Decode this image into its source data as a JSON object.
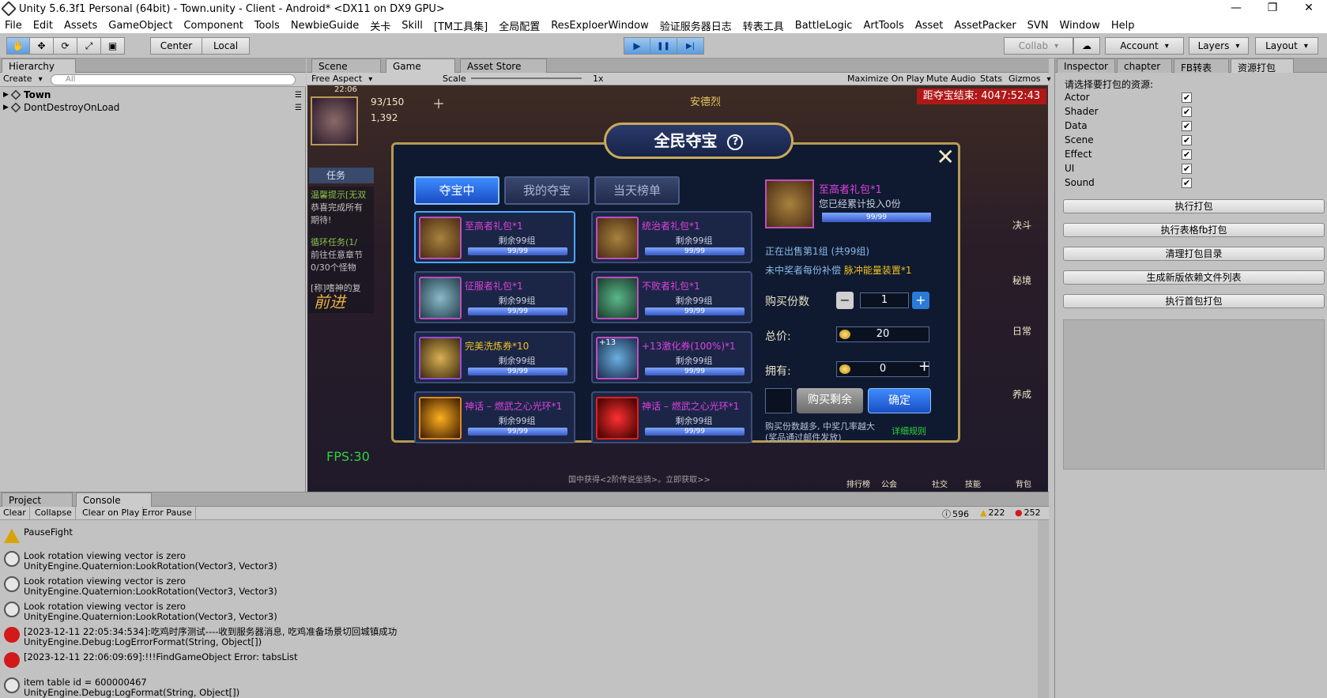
{
  "window": {
    "title": "Unity 5.6.3f1 Personal (64bit) - Town.unity - Client - Android* <DX11 on DX9 GPU>",
    "btn_min": "—",
    "btn_max": "❐",
    "btn_close": "✕"
  },
  "menu": [
    "File",
    "Edit",
    "Assets",
    "GameObject",
    "Component",
    "Tools",
    "NewbieGuide",
    "关卡",
    "Skill",
    "[TM工具集]",
    "全局配置",
    "ResExploerWindow",
    "验证服务器日志",
    "转表工具",
    "BattleLogic",
    "ArtTools",
    "Asset",
    "AssetPacker",
    "SVN",
    "Window",
    "Help"
  ],
  "toolbar": {
    "transform_tools": [
      "✋",
      "✥",
      "⟳",
      "⤢",
      "▣"
    ],
    "pivot": "Center",
    "space": "Local",
    "play": "▶",
    "pause": "❚❚",
    "step": "▶|",
    "collab": "Collab",
    "cloud": "☁",
    "account": "Account",
    "layers": "Layers",
    "layout": "Layout"
  },
  "hierarchy": {
    "tab": "Hierarchy",
    "create": "Create",
    "search_placeholder": "All",
    "items": [
      "Town",
      "DontDestroyOnLoad"
    ]
  },
  "game_panel": {
    "tabs": {
      "scene": "Scene",
      "game": "Game",
      "asset_store": "Asset Store"
    },
    "aspect": "Free Aspect",
    "scale_label": "Scale",
    "scale_value": "1x",
    "toggles": [
      "Maximize On Play",
      "Mute Audio",
      "Stats",
      "Gizmos"
    ]
  },
  "game": {
    "time": "22:06",
    "energy": "93/150",
    "gold": "1,392",
    "npc_name": "安德烈",
    "countdown": "距夺宝结束: 4047:52:43",
    "fps": "FPS:30",
    "task_label": "任务",
    "task_lines": [
      "温馨提示[无双",
      "恭喜完成所有",
      "期待!",
      "循环任务(1/",
      "前往任意章节",
      "0/30个怪物",
      "[称]嗜神的复"
    ],
    "forward": "前进",
    "side_icons": [
      "决斗",
      "秘境",
      "日常",
      "养成"
    ],
    "bottom_icons": [
      "排行榜",
      "公会",
      "社交",
      "技能",
      "背包"
    ],
    "bottom_hint": "国中获得<2阶传说坐骑>。立即获取>>",
    "dialog": {
      "title": "全民夺宝",
      "help": "?",
      "close": "✕",
      "tabs": [
        "夺宝中",
        "我的夺宝",
        "当天榜单"
      ],
      "items": [
        {
          "name": "至高者礼包*1",
          "remain": "剩余99组",
          "progress": "99/99"
        },
        {
          "name": "统治者礼包*1",
          "remain": "剩余99组",
          "progress": "99/99"
        },
        {
          "name": "征服者礼包*1",
          "remain": "剩余99组",
          "progress": "99/99"
        },
        {
          "name": "不败者礼包*1",
          "remain": "剩余99组",
          "progress": "99/99"
        },
        {
          "name": "完美洗炼券*10",
          "remain": "剩余99组",
          "progress": "99/99"
        },
        {
          "name": "+13激化券(100%)*1",
          "remain": "剩余99组",
          "progress": "99/99"
        },
        {
          "name": "神话 – 燃武之心光环*1",
          "remain": "剩余99组",
          "progress": "99/99"
        },
        {
          "name": "神话 – 燃武之心光环*1",
          "remain": "剩余99组",
          "progress": "99/99"
        }
      ],
      "item6_badge": "+13",
      "detail": {
        "name": "至高者礼包*1",
        "invested": "您已经累计投入0份",
        "progress": "99/99",
        "on_sale": "正在出售第1组 (共99组)",
        "compensation_prefix": "未中奖者每份补偿",
        "compensation_item": "脉冲能量装置*1",
        "buy_qty_label": "购买份数",
        "buy_qty": "1",
        "total_label": "总价:",
        "total_value": "20",
        "own_label": "拥有:",
        "own_value": "0",
        "buy_rest": "购买剩余",
        "confirm": "确定",
        "note1": "购买份数越多, 中奖几率越大",
        "note2": "(奖品通过邮件发放)",
        "rules": "详细规则"
      }
    }
  },
  "console": {
    "tabs": {
      "project": "Project",
      "console": "Console"
    },
    "buttons": [
      "Clear",
      "Collapse",
      "Clear on Play",
      "Error Pause"
    ],
    "counts": {
      "info": "596",
      "warn": "222",
      "error": "252"
    },
    "logs": [
      {
        "type": "warn",
        "line1": "PauseFight",
        "line2": ""
      },
      {
        "type": "info",
        "line1": "Look rotation viewing vector is zero",
        "line2": "UnityEngine.Quaternion:LookRotation(Vector3, Vector3)"
      },
      {
        "type": "info",
        "line1": "Look rotation viewing vector is zero",
        "line2": "UnityEngine.Quaternion:LookRotation(Vector3, Vector3)"
      },
      {
        "type": "info",
        "line1": "Look rotation viewing vector is zero",
        "line2": "UnityEngine.Quaternion:LookRotation(Vector3, Vector3)"
      },
      {
        "type": "error",
        "line1": "[2023-12-11 22:05:34:534]:吃鸡时序测试----收到服务器消息, 吃鸡准备场景切回城镇成功",
        "line2": "UnityEngine.Debug:LogErrorFormat(String, Object[])"
      },
      {
        "type": "error",
        "line1": "[2023-12-11 22:06:09:69]:!!!FindGameObject Error: tabsList",
        "line2": ""
      },
      {
        "type": "info",
        "line1": "item table id = 600000467",
        "line2": "UnityEngine.Debug:LogFormat(String, Object[])"
      }
    ]
  },
  "inspector": {
    "tabs": [
      "Inspector",
      "chapter",
      "FB转表",
      "资源打包"
    ],
    "prompt": "请选择要打包的资源:",
    "options": [
      {
        "label": "Actor",
        "checked": "✔"
      },
      {
        "label": "Shader",
        "checked": "✔"
      },
      {
        "label": "Data",
        "checked": "✔"
      },
      {
        "label": "Scene",
        "checked": "✔"
      },
      {
        "label": "Effect",
        "checked": "✔"
      },
      {
        "label": "UI",
        "checked": "✔"
      },
      {
        "label": "Sound",
        "checked": "✔"
      }
    ],
    "buttons": [
      "执行打包",
      "执行表格fb打包",
      "清理打包目录",
      "生成新版依赖文件列表",
      "执行首包打包"
    ]
  }
}
